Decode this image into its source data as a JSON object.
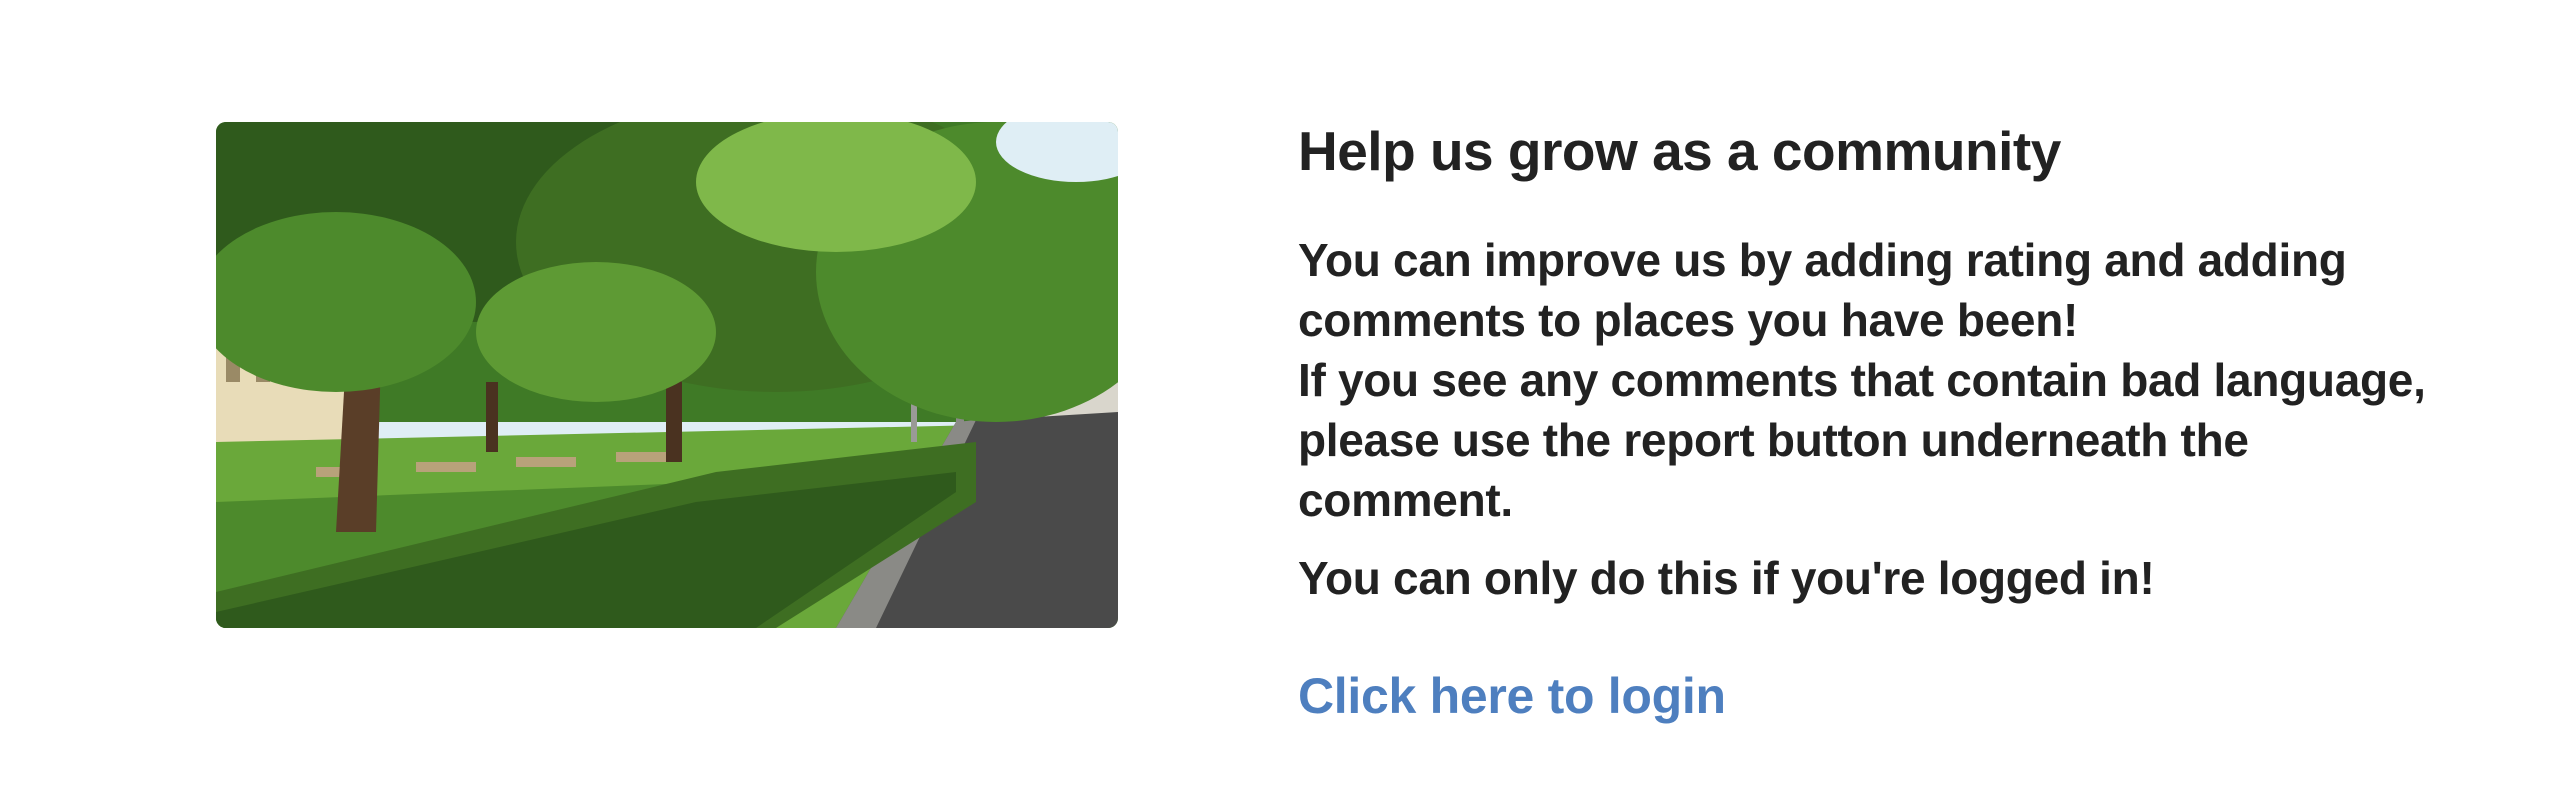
{
  "image": {
    "alt_icon": "park-photo",
    "colors": {
      "foliage_dark": "#2f5a1c",
      "foliage_mid": "#4d8a2c",
      "foliage_light": "#7fb84a",
      "sky": "#dfeef5",
      "building": "#e8dcb8",
      "path": "#4a4a4a",
      "hedge": "#3e6e22"
    }
  },
  "heading": "Help us grow as a community",
  "paragraph1": "You can improve us by adding rating and adding comments to places you have been!",
  "paragraph2": "If you see any comments that contain bad language, please use the report button underneath the comment.",
  "paragraph3": "You can only do this if you're logged in!",
  "login_link": "Click here to login",
  "colors": {
    "text": "#222222",
    "link": "#4e7fbf",
    "background": "#ffffff"
  }
}
